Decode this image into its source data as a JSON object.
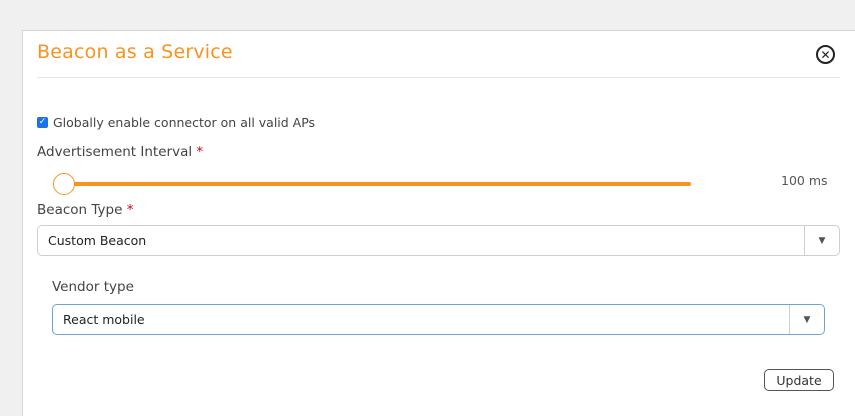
{
  "dialog": {
    "title": "Beacon as a Service",
    "close_icon": "close-circle-icon",
    "accent_color": "#f7931e"
  },
  "connector": {
    "checkbox_label": "Globally enable connector on all valid APs",
    "checked": true
  },
  "advertisement_interval": {
    "label": "Advertisement Interval",
    "required_mark": "*",
    "value_text": "100 ms",
    "slider_level": 0.0
  },
  "beacon_type": {
    "label": "Beacon Type",
    "required_mark": "*",
    "selected": "Custom Beacon"
  },
  "vendor_type": {
    "label": "Vendor type",
    "selected": "React mobile"
  },
  "actions": {
    "update_label": "Update"
  }
}
